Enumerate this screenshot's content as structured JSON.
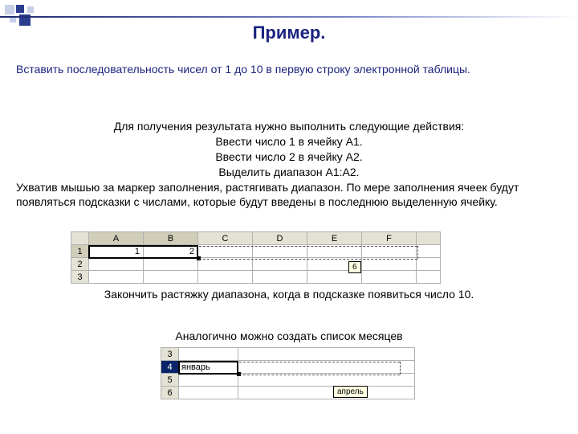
{
  "title": "Пример.",
  "intro": "Вставить последовательность чисел от 1 до 10 в первую строку электронной таблицы.",
  "instr": {
    "l1": "Для получения результата нужно выполнить следующие действия:",
    "l2": "Ввести число 1 в ячейку А1.",
    "l3": "Ввести число 2 в ячейку А2.",
    "l4": "Выделить диапазон А1:А2.",
    "l5": "Ухватив мышью за маркер заполнения, растягивать диапазон. По мере заполнения ячеек будут появляться подсказки с числами, которые будут введены в последнюю выделенную ячейку."
  },
  "sheet1": {
    "cols": [
      "A",
      "B",
      "C",
      "D",
      "E",
      "F",
      ""
    ],
    "rows": [
      "1",
      "2",
      "3"
    ],
    "a1": "1",
    "b1": "2",
    "tooltip": "6"
  },
  "post1": "Закончить растяжку диапазона, когда в подсказке появиться число 10.",
  "post2": "Аналогично можно создать список месяцев",
  "sheet2": {
    "rows": [
      "3",
      "4",
      "5",
      "6"
    ],
    "a4": "январь",
    "tooltip": "апрель"
  }
}
